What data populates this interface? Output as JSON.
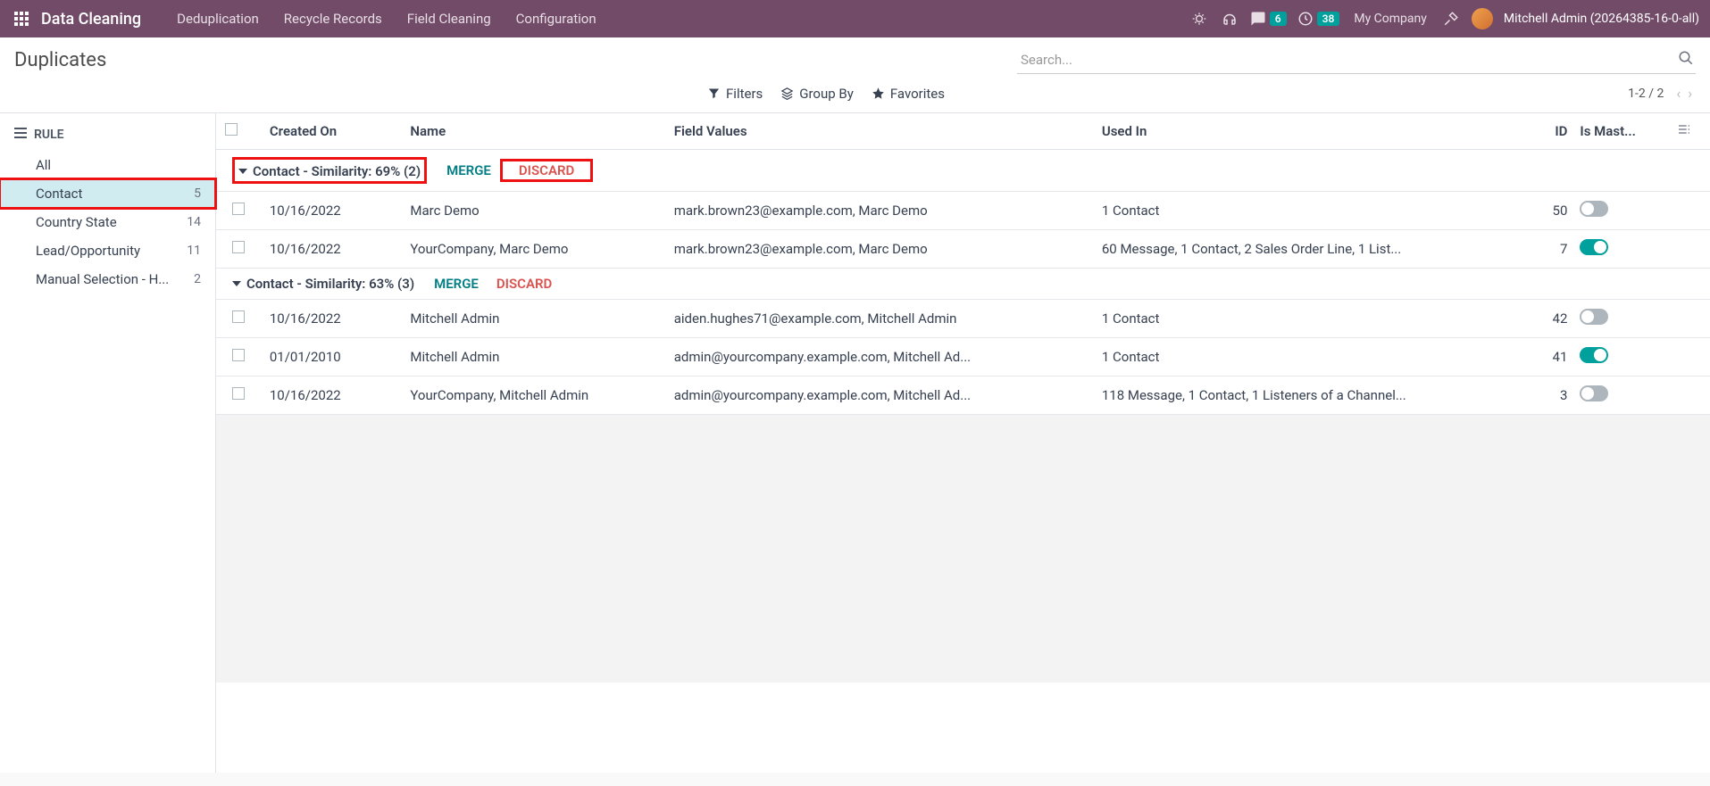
{
  "navbar": {
    "brand": "Data Cleaning",
    "links": [
      "Deduplication",
      "Recycle Records",
      "Field Cleaning",
      "Configuration"
    ],
    "messages_badge": "6",
    "activities_badge": "38",
    "company": "My Company",
    "user": "Mitchell Admin (20264385-16-0-all)"
  },
  "breadcrumb": "Duplicates",
  "search": {
    "placeholder": "Search..."
  },
  "filters": {
    "filters_label": "Filters",
    "group_by_label": "Group By",
    "favorites_label": "Favorites"
  },
  "pager": {
    "range": "1-2 / 2"
  },
  "sidebar": {
    "header": "RULE",
    "items": [
      {
        "label": "All",
        "count": ""
      },
      {
        "label": "Contact",
        "count": "5",
        "active": true,
        "highlight": true
      },
      {
        "label": "Country State",
        "count": "14"
      },
      {
        "label": "Lead/Opportunity",
        "count": "11"
      },
      {
        "label": "Manual Selection - H...",
        "count": "2"
      }
    ]
  },
  "table": {
    "headers": {
      "created": "Created On",
      "name": "Name",
      "field_values": "Field Values",
      "used_in": "Used In",
      "id": "ID",
      "is_master": "Is Mast..."
    },
    "merge_label": "MERGE",
    "discard_label": "DISCARD",
    "groups": [
      {
        "title": "Contact - Similarity: 69% (2)",
        "highlight_title": true,
        "highlight_discard": true,
        "rows": [
          {
            "created": "10/16/2022",
            "name": "Marc Demo",
            "field_values": "mark.brown23@example.com, Marc Demo",
            "used_in": "1 Contact",
            "id": "50",
            "master": false
          },
          {
            "created": "10/16/2022",
            "name": "YourCompany, Marc Demo",
            "field_values": "mark.brown23@example.com, Marc Demo",
            "used_in": "60 Message, 1 Contact, 2 Sales Order Line, 1 List...",
            "id": "7",
            "master": true
          }
        ]
      },
      {
        "title": "Contact - Similarity: 63% (3)",
        "rows": [
          {
            "created": "10/16/2022",
            "name": "Mitchell Admin",
            "field_values": "aiden.hughes71@example.com, Mitchell Admin",
            "used_in": "1 Contact",
            "id": "42",
            "master": false
          },
          {
            "created": "01/01/2010",
            "name": "Mitchell Admin",
            "field_values": "admin@yourcompany.example.com, Mitchell Ad...",
            "used_in": "1 Contact",
            "id": "41",
            "master": true
          },
          {
            "created": "10/16/2022",
            "name": "YourCompany, Mitchell Admin",
            "field_values": "admin@yourcompany.example.com, Mitchell Ad...",
            "used_in": "118 Message, 1 Contact, 1 Listeners of a Channel...",
            "id": "3",
            "master": false
          }
        ]
      }
    ]
  }
}
